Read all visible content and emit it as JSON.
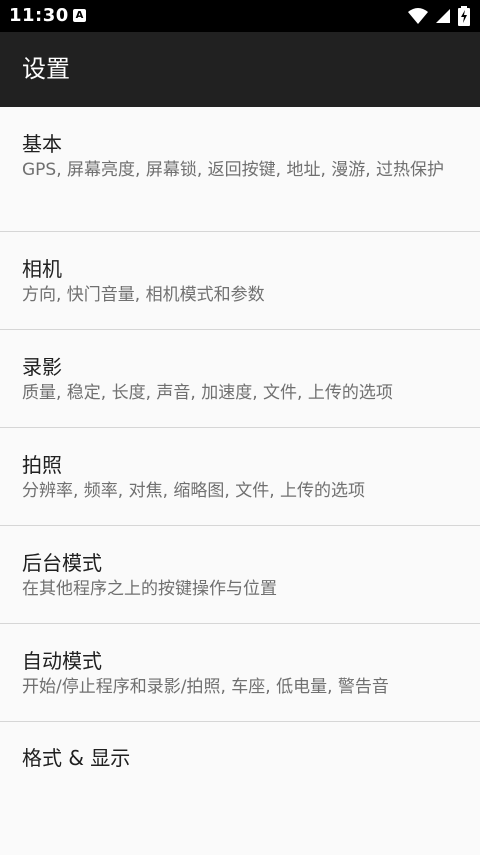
{
  "status_bar": {
    "time": "11:30",
    "notification_glyph": "A",
    "icons": [
      "wifi-icon",
      "signal-icon",
      "battery-charging-icon"
    ]
  },
  "app_bar": {
    "title": "设置"
  },
  "settings": [
    {
      "title": "基本",
      "summary": "GPS, 屏幕亮度, 屏幕锁, 返回按键, 地址, 漫游, 过热保护"
    },
    {
      "title": "相机",
      "summary": "方向, 快门音量, 相机模式和参数"
    },
    {
      "title": "录影",
      "summary": "质量, 稳定, 长度, 声音, 加速度, 文件, 上传的选项"
    },
    {
      "title": "拍照",
      "summary": "分辨率, 频率, 对焦, 缩略图, 文件, 上传的选项"
    },
    {
      "title": "后台模式",
      "summary": "在其他程序之上的按键操作与位置"
    },
    {
      "title": "自动模式",
      "summary": "开始/停止程序和录影/拍照, 车座, 低电量, 警告音"
    },
    {
      "title": "格式 & 显示",
      "summary": ""
    }
  ],
  "colors": {
    "status_bar": "#000000",
    "app_bar": "#212121",
    "background": "#fafafa",
    "title_text": "#202020",
    "summary_text": "#707070",
    "divider": "#d6d6d6"
  }
}
